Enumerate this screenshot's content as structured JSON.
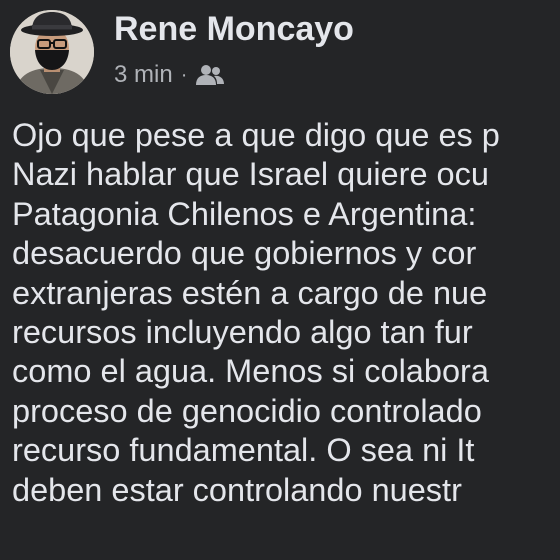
{
  "post": {
    "author": "Rene Moncayo",
    "time": "3 min",
    "separator": "·",
    "audience_icon": "friends-icon",
    "lines": [
      "Ojo que pese a que digo que es p",
      "Nazi hablar que Israel quiere ocu",
      "Patagonia Chilenos e Argentina:",
      "desacuerdo que gobiernos y cor",
      "extranjeras estén a cargo de nue",
      "recursos incluyendo algo tan fur",
      "como el agua. Menos si colabora",
      "proceso de genocidio controlado",
      "recurso fundamental. O sea ni It",
      "deben estar controlando nuestr"
    ]
  },
  "colors": {
    "background": "#242527",
    "primary_text": "#e4e6eb",
    "secondary_text": "#b0b3b8"
  }
}
